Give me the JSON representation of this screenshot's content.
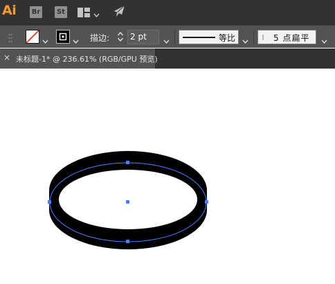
{
  "app": {
    "logo_text": "Ai",
    "logo_color": "#f29a38",
    "bridge_badge": "Br",
    "stock_badge": "St",
    "icons": [
      "layout-icon",
      "chevron-down-icon",
      "sync-icon"
    ]
  },
  "control_bar": {
    "fill_swatch": "none",
    "stroke_swatch_color": "#000000",
    "stroke_label": "描边:",
    "stroke_weight": "2 pt",
    "variable_width_profile": "等比",
    "brush_definition": "5 点扁平"
  },
  "document_tab": {
    "close_glyph": "×",
    "title": "未标题-1* @ 236.61% (RGB/GPU 预览)"
  },
  "canvas": {
    "shape": "ellipse",
    "shape_fill": "#000000",
    "selection_color": "#4a7dff",
    "background": "#ffffff"
  }
}
